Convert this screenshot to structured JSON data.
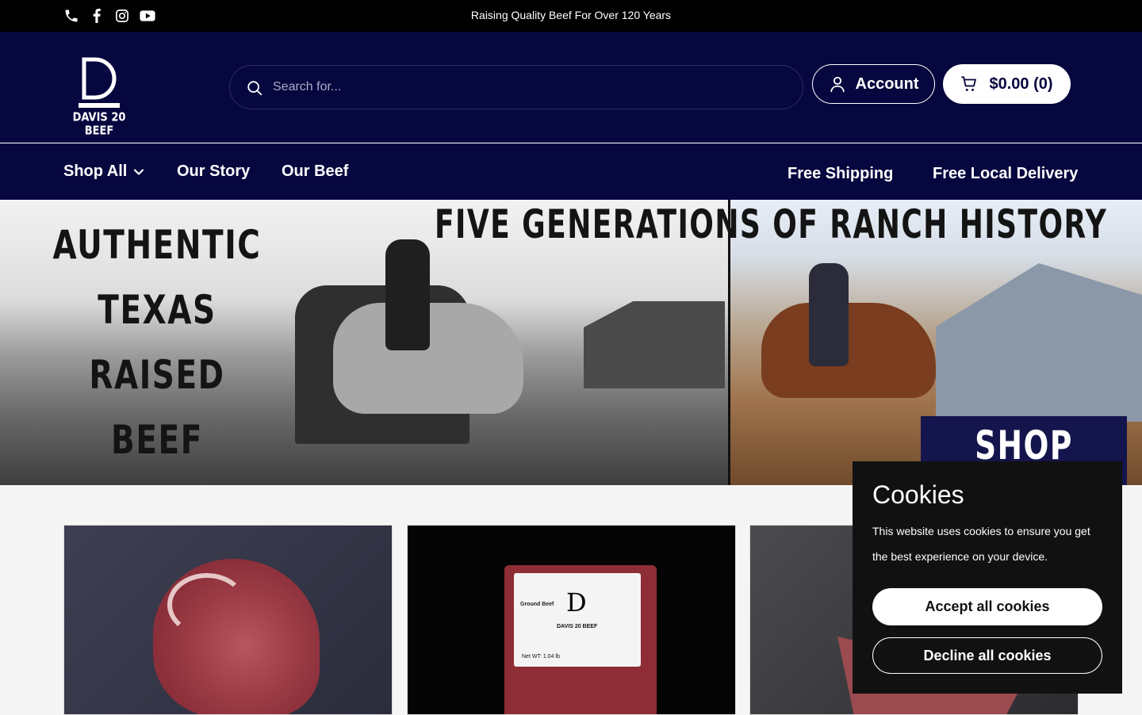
{
  "announcement": "Raising Quality Beef For Over 120 Years",
  "social_icons": [
    "phone-icon",
    "facebook-icon",
    "instagram-icon",
    "youtube-icon"
  ],
  "brand": {
    "wordmark": "DAVIS 20 BEEF",
    "mark": "D"
  },
  "search": {
    "placeholder": "Search for..."
  },
  "header": {
    "account_label": "Account",
    "cart_label": "$0.00 (0)"
  },
  "nav": {
    "shop_all": "Shop All",
    "our_story": "Our Story",
    "our_beef": "Our Beef",
    "free_shipping": "Free Shipping",
    "free_local_delivery": "Free Local Delivery"
  },
  "hero": {
    "left_lines": [
      "AUTHENTIC",
      "TEXAS",
      "RAISED",
      "BEEF"
    ],
    "headline": "FIVE GENERATIONS OF RANCH HISTORY",
    "cta": "SHOP NOW"
  },
  "product_cards": [
    {
      "image": "ribeye steak"
    },
    {
      "image": "ground beef package",
      "label_title": "Ground Beef",
      "label_brand": "DAVIS 20 BEEF",
      "label_net": "Net WT: 1.04 lb"
    },
    {
      "image": "ribs"
    }
  ],
  "cookies": {
    "title": "Cookies",
    "body": "This website uses cookies to ensure you get the best experience on your device.",
    "accept": "Accept all cookies",
    "decline": "Decline all cookies"
  },
  "colors": {
    "navy": "#07073f",
    "black": "#000000",
    "white": "#ffffff"
  }
}
